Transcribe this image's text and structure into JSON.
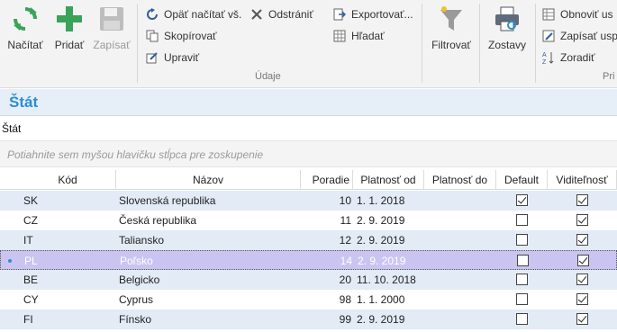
{
  "ribbon": {
    "load_label": "Načítať",
    "add_label": "Pridať",
    "save_label": "Zapísať",
    "reload_all_label": "Opäť načítať vš.",
    "remove_label": "Odstrániť",
    "copy_label": "Skopírovať",
    "edit_label": "Upraviť",
    "export_label": "Exportovať...",
    "search_label": "Hľadať",
    "data_group_label": "Údaje",
    "filter_label": "Filtrovať",
    "reports_label": "Zostavy",
    "refresh_label": "Obnoviť us",
    "write_label": "Zapísať usp",
    "sort_label": "Zoradiť",
    "group_partial_label": "Pri"
  },
  "page": {
    "title": "Štát",
    "subtitle": "Štát",
    "group_hint": "Potiahnite sem myšou hlavičku stĺpca pre zoskupenie"
  },
  "grid": {
    "columns": {
      "code": "Kód",
      "name": "Názov",
      "order": "Poradie",
      "valid_from": "Platnosť od",
      "valid_to": "Platnosť do",
      "default": "Default",
      "visibility": "Viditeľnosť"
    },
    "rows": [
      {
        "code": "SK",
        "name": "Slovenská republika",
        "order": "10",
        "valid_from": "1. 1. 2018",
        "valid_to": "",
        "default": true,
        "visible": true
      },
      {
        "code": "CZ",
        "name": "Česká republika",
        "order": "11",
        "valid_from": "2. 9. 2019",
        "valid_to": "",
        "default": false,
        "visible": true
      },
      {
        "code": "IT",
        "name": "Taliansko",
        "order": "12",
        "valid_from": "2. 9. 2019",
        "valid_to": "",
        "default": false,
        "visible": true
      },
      {
        "code": "PL",
        "name": "Poľsko",
        "order": "14",
        "valid_from": "2. 9. 2019",
        "valid_to": "",
        "default": false,
        "visible": true
      },
      {
        "code": "BE",
        "name": "Belgicko",
        "order": "20",
        "valid_from": "11. 10. 2018",
        "valid_to": "",
        "default": false,
        "visible": true
      },
      {
        "code": "CY",
        "name": "Cyprus",
        "order": "98",
        "valid_from": "1. 1. 2000",
        "valid_to": "",
        "default": false,
        "visible": true
      },
      {
        "code": "FI",
        "name": "Fínsko",
        "order": "99",
        "valid_from": "2. 9. 2019",
        "valid_to": "",
        "default": false,
        "visible": true
      }
    ]
  },
  "colors": {
    "accent": "#2b8fd0",
    "row_alt": "#e2ebf6",
    "row_selected": "#c9c5f0"
  }
}
